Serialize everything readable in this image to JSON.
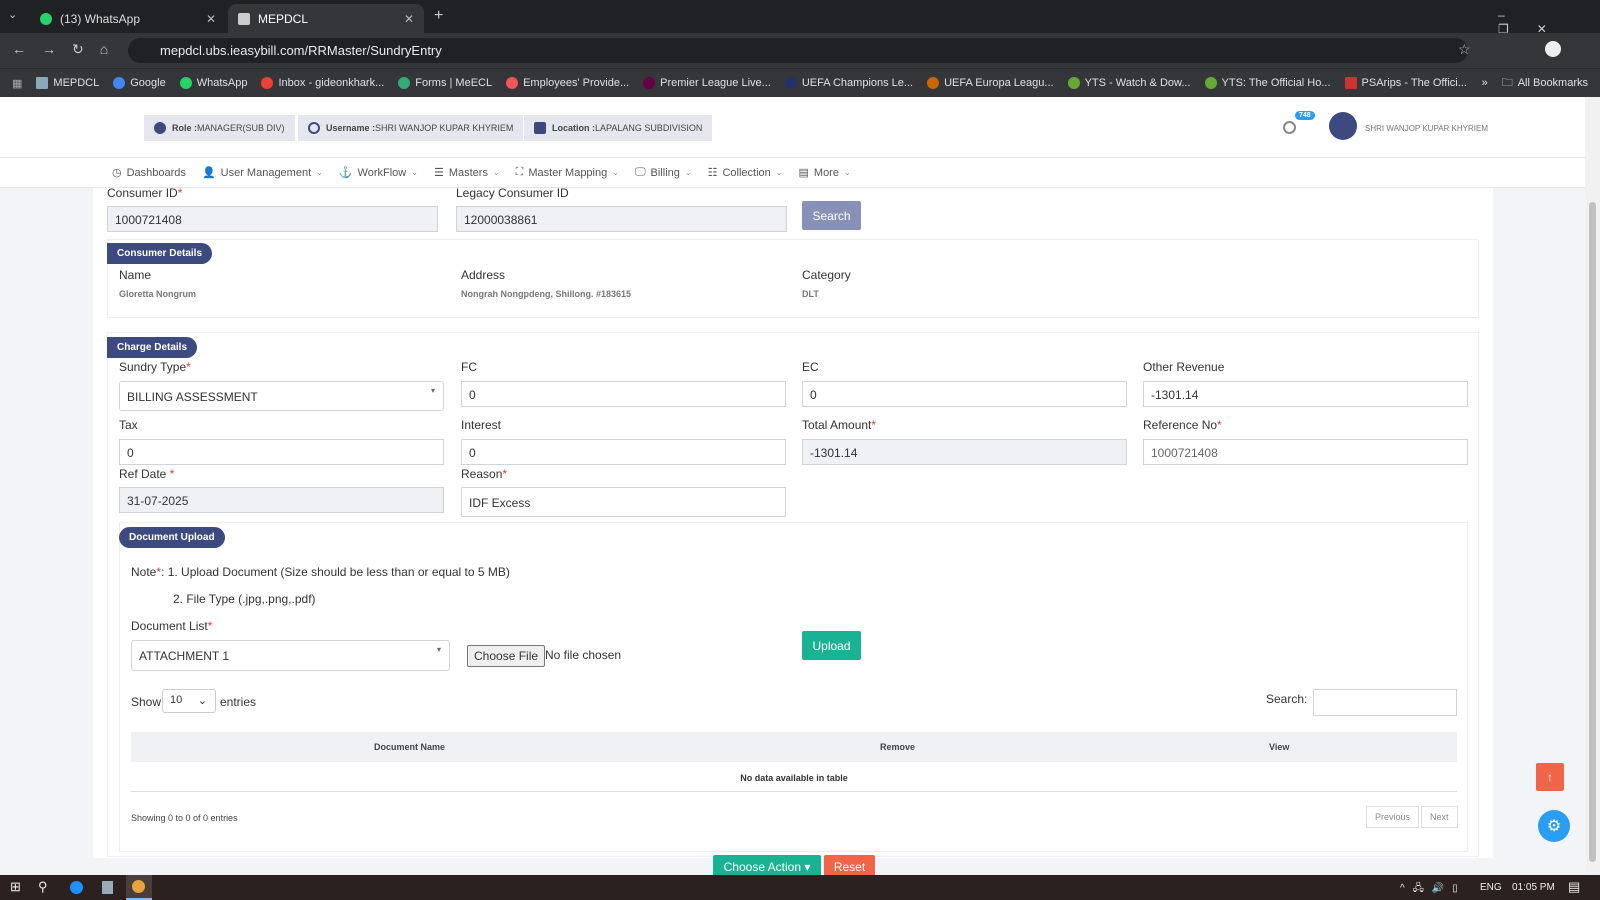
{
  "browser": {
    "tabs": [
      {
        "label": "(13) WhatsApp",
        "active": false
      },
      {
        "label": "MEPDCL",
        "active": true
      }
    ],
    "url": "mepdcl.ubs.ieasybill.com/RRMaster/SundryEntry",
    "bookmarks": [
      "MEPDCL",
      "Google",
      "WhatsApp",
      "Inbox - gideonkhark...",
      "Forms | MeECL",
      "Employees' Provide...",
      "Premier League Live...",
      "UEFA Champions Le...",
      "UEFA Europa Leagu...",
      "YTS - Watch & Dow...",
      "YTS: The Official Ho...",
      "PSArips - The Offici..."
    ],
    "all_bookmarks": "All Bookmarks"
  },
  "header": {
    "role_label": "Role :",
    "role": "MANAGER(SUB DIV)",
    "username_label": "Username :",
    "username": "SHRI WANJOP KUPAR KHYRIEM",
    "location_label": "Location :",
    "location": "LAPALANG SUBDIVISION",
    "notif_count": "748",
    "user_name": "SHRI WANJOP KUPAR KHYRIEM"
  },
  "nav": [
    "Dashboards",
    "User Management",
    "WorkFlow",
    "Masters",
    "Master Mapping",
    "Billing",
    "Collection",
    "More"
  ],
  "search": {
    "consumer_id_label": "Consumer ID",
    "consumer_id": "1000721408",
    "legacy_label": "Legacy Consumer ID",
    "legacy": "12000038861",
    "button": "Search"
  },
  "consumer": {
    "badge": "Consumer Details",
    "name_label": "Name",
    "name": "Gloretta Nongrum",
    "address_label": "Address",
    "address": "Nongrah Nongpdeng, Shillong. #183615",
    "category_label": "Category",
    "category": "DLT"
  },
  "charge": {
    "badge": "Charge Details",
    "sundry_label": "Sundry Type",
    "sundry": "BILLING ASSESSMENT",
    "fc_label": "FC",
    "fc": "0",
    "ec_label": "EC",
    "ec": "0",
    "other_label": "Other Revenue",
    "other": "-1301.14",
    "tax_label": "Tax",
    "tax": "0",
    "interest_label": "Interest",
    "interest": "0",
    "total_label": "Total Amount",
    "total": "-1301.14",
    "ref_label": "Reference No",
    "ref": "1000721408",
    "refdate_label": "Ref Date",
    "refdate": "31-07-2025",
    "reason_label": "Reason",
    "reason": "IDF Excess"
  },
  "upload": {
    "badge": "Document Upload",
    "note1": "1. Upload Document (Size should be less than or equal to 5 MB)",
    "note_prefix": "Note",
    "note2": "2. File Type (.jpg,.png,.pdf)",
    "doclist_label": "Document List",
    "doclist": "ATTACHMENT 1",
    "choose": "Choose File",
    "nofile": "No file chosen",
    "button": "Upload"
  },
  "table": {
    "show": "Show",
    "entries_value": "10",
    "entries": "entries",
    "search_label": "Search:",
    "columns": [
      "Document Name",
      "Remove",
      "View"
    ],
    "empty": "No data available in table",
    "info": "Showing 0 to 0 of 0 entries",
    "prev": "Previous",
    "next": "Next"
  },
  "actions": {
    "choose": "Choose Action ▾",
    "reset": "Reset"
  },
  "taskbar": {
    "lang": "ENG",
    "time": "01:05 PM"
  }
}
